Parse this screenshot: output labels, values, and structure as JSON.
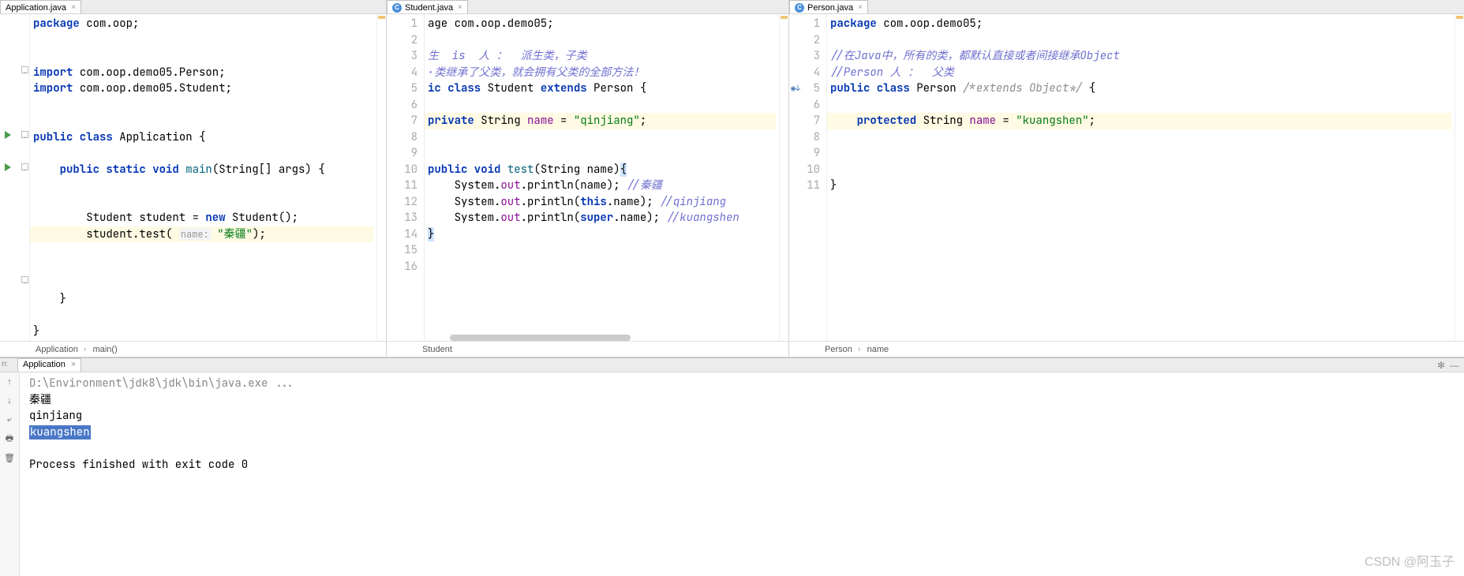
{
  "pane1": {
    "tab": "Application.java",
    "code": [
      {
        "t": "kw",
        "v": "package"
      },
      {
        "t": "sp",
        "v": " "
      },
      {
        "t": "pkg",
        "v": "com.oop"
      },
      {
        "t": "pkg",
        "v": ";"
      },
      {
        "t": "nl"
      },
      {
        "t": "nl"
      },
      {
        "t": "nl"
      },
      {
        "t": "kw",
        "v": "import"
      },
      {
        "t": "sp",
        "v": " "
      },
      {
        "t": "pkg",
        "v": "com.oop.demo05.Person;"
      },
      {
        "t": "nl"
      },
      {
        "t": "kw",
        "v": "import"
      },
      {
        "t": "sp",
        "v": " "
      },
      {
        "t": "pkg",
        "v": "com.oop.demo05.Student;"
      },
      {
        "t": "nl"
      },
      {
        "t": "nl"
      },
      {
        "t": "nl"
      },
      {
        "t": "kw",
        "v": "public class"
      },
      {
        "t": "sp",
        "v": " "
      },
      {
        "t": "cls",
        "v": "Application"
      },
      {
        "t": "sp",
        "v": " {"
      },
      {
        "t": "nl"
      },
      {
        "t": "nl"
      },
      {
        "t": "sp",
        "v": "    "
      },
      {
        "t": "kw",
        "v": "public static void"
      },
      {
        "t": "sp",
        "v": " "
      },
      {
        "t": "mth",
        "v": "main"
      },
      {
        "t": "sp",
        "v": "(String[] args) {"
      },
      {
        "t": "nl"
      },
      {
        "t": "nl"
      },
      {
        "t": "nl"
      },
      {
        "t": "sp",
        "v": "        Student student = "
      },
      {
        "t": "kw",
        "v": "new"
      },
      {
        "t": "sp",
        "v": " Student();"
      },
      {
        "t": "nl"
      },
      {
        "t": "hl-start"
      },
      {
        "t": "sp",
        "v": "        student.test( "
      },
      {
        "t": "hint",
        "v": "name:"
      },
      {
        "t": "sp",
        "v": " "
      },
      {
        "t": "str",
        "v": "\"秦疆\""
      },
      {
        "t": "sp",
        "v": ");"
      },
      {
        "t": "hl-end"
      },
      {
        "t": "nl"
      },
      {
        "t": "nl"
      },
      {
        "t": "nl"
      },
      {
        "t": "sp",
        "v": "    }"
      },
      {
        "t": "nl"
      },
      {
        "t": "nl"
      },
      {
        "t": "sp",
        "v": "}"
      },
      {
        "t": "nl"
      }
    ],
    "breadcrumb": [
      "Application",
      "main()"
    ]
  },
  "pane2": {
    "tab": "Student.java",
    "lines": [
      "1",
      "2",
      "3",
      "4",
      "5",
      "6",
      "7",
      "8",
      "9",
      "10",
      "11",
      "12",
      "13",
      "14",
      "15",
      "16"
    ],
    "code": [
      {
        "t": "pkg",
        "v": "age com.oop.demo05;"
      },
      {
        "t": "nl"
      },
      {
        "t": "nl"
      },
      {
        "t": "cmtb",
        "v": "生  is  人 ：  派生类，子类"
      },
      {
        "t": "nl"
      },
      {
        "t": "cmtb",
        "v": "·类继承了父类，就会拥有父类的全部方法！"
      },
      {
        "t": "nl"
      },
      {
        "t": "kw",
        "v": "ic class"
      },
      {
        "t": "sp",
        "v": " "
      },
      {
        "t": "cls",
        "v": "Student"
      },
      {
        "t": "sp",
        "v": " "
      },
      {
        "t": "kw",
        "v": "extends"
      },
      {
        "t": "sp",
        "v": " "
      },
      {
        "t": "cls",
        "v": "Person"
      },
      {
        "t": "sp",
        "v": " {"
      },
      {
        "t": "nl"
      },
      {
        "t": "nl"
      },
      {
        "t": "hl-start"
      },
      {
        "t": "kw",
        "v": "private"
      },
      {
        "t": "sp",
        "v": " String "
      },
      {
        "t": "fld",
        "v": "name"
      },
      {
        "t": "sp",
        "v": " = "
      },
      {
        "t": "str",
        "v": "\"qinjiang\""
      },
      {
        "t": "sp",
        "v": ";"
      },
      {
        "t": "hl-end"
      },
      {
        "t": "nl"
      },
      {
        "t": "nl"
      },
      {
        "t": "kw",
        "v": "public void"
      },
      {
        "t": "sp",
        "v": " "
      },
      {
        "t": "mth",
        "v": "test"
      },
      {
        "t": "sp",
        "v": "(String name)"
      },
      {
        "t": "sel",
        "v": "{"
      },
      {
        "t": "nl"
      },
      {
        "t": "sp",
        "v": "    System."
      },
      {
        "t": "fld",
        "v": "out"
      },
      {
        "t": "sp",
        "v": ".println(name); "
      },
      {
        "t": "cmtb",
        "v": "//秦疆"
      },
      {
        "t": "nl"
      },
      {
        "t": "sp",
        "v": "    System."
      },
      {
        "t": "fld",
        "v": "out"
      },
      {
        "t": "sp",
        "v": ".println("
      },
      {
        "t": "kw",
        "v": "this"
      },
      {
        "t": "sp",
        "v": ".name); "
      },
      {
        "t": "cmtb",
        "v": "//qinjiang"
      },
      {
        "t": "nl"
      },
      {
        "t": "sp",
        "v": "    System."
      },
      {
        "t": "fld",
        "v": "out"
      },
      {
        "t": "sp",
        "v": ".println("
      },
      {
        "t": "kw",
        "v": "super"
      },
      {
        "t": "sp",
        "v": ".name); "
      },
      {
        "t": "cmtb",
        "v": "//kuangshen"
      },
      {
        "t": "nl"
      },
      {
        "t": "sel",
        "v": "}"
      },
      {
        "t": "nl"
      },
      {
        "t": "nl"
      },
      {
        "t": "nl"
      },
      {
        "t": "nl"
      }
    ],
    "breadcrumb": [
      "Student"
    ]
  },
  "pane3": {
    "tab": "Person.java",
    "lines": [
      "1",
      "2",
      "3",
      "4",
      "5",
      "6",
      "7",
      "8",
      "9",
      "10",
      "11"
    ],
    "code": [
      {
        "t": "kw",
        "v": "package"
      },
      {
        "t": "sp",
        "v": " "
      },
      {
        "t": "pkg",
        "v": "com.oop.demo05;"
      },
      {
        "t": "nl"
      },
      {
        "t": "nl"
      },
      {
        "t": "cmtb",
        "v": "//在Java中，所有的类，都默认直接或者间接继承Object"
      },
      {
        "t": "nl"
      },
      {
        "t": "cmtb",
        "v": "//Person 人 ：  父类"
      },
      {
        "t": "nl"
      },
      {
        "t": "kw",
        "v": "public class"
      },
      {
        "t": "sp",
        "v": " "
      },
      {
        "t": "cls",
        "v": "Person"
      },
      {
        "t": "sp",
        "v": " "
      },
      {
        "t": "cmt",
        "v": "/*extends Object*/"
      },
      {
        "t": "sp",
        "v": " {"
      },
      {
        "t": "nl"
      },
      {
        "t": "nl"
      },
      {
        "t": "hl-start"
      },
      {
        "t": "sp",
        "v": "    "
      },
      {
        "t": "kw",
        "v": "protected"
      },
      {
        "t": "sp",
        "v": " String "
      },
      {
        "t": "fld",
        "v": "name"
      },
      {
        "t": "sp",
        "v": " = "
      },
      {
        "t": "str",
        "v": "\"kuangshen\""
      },
      {
        "t": "sp",
        "v": ";"
      },
      {
        "t": "hl-end"
      },
      {
        "t": "nl"
      },
      {
        "t": "nl"
      },
      {
        "t": "nl"
      },
      {
        "t": "sp",
        "v": "}"
      },
      {
        "t": "nl"
      },
      {
        "t": "nl"
      }
    ],
    "breadcrumb": [
      "Person",
      "name"
    ]
  },
  "console": {
    "tab": "Application",
    "out_cmd": "D:\\Environment\\jdk8\\jdk\\bin\\java.exe ...",
    "out1": "秦疆",
    "out2": "qinjiang",
    "out3": "kuangshen",
    "out_exit": "Process finished with exit code 0",
    "runLabel": "n:"
  },
  "watermark": "CSDN @阿玉子"
}
